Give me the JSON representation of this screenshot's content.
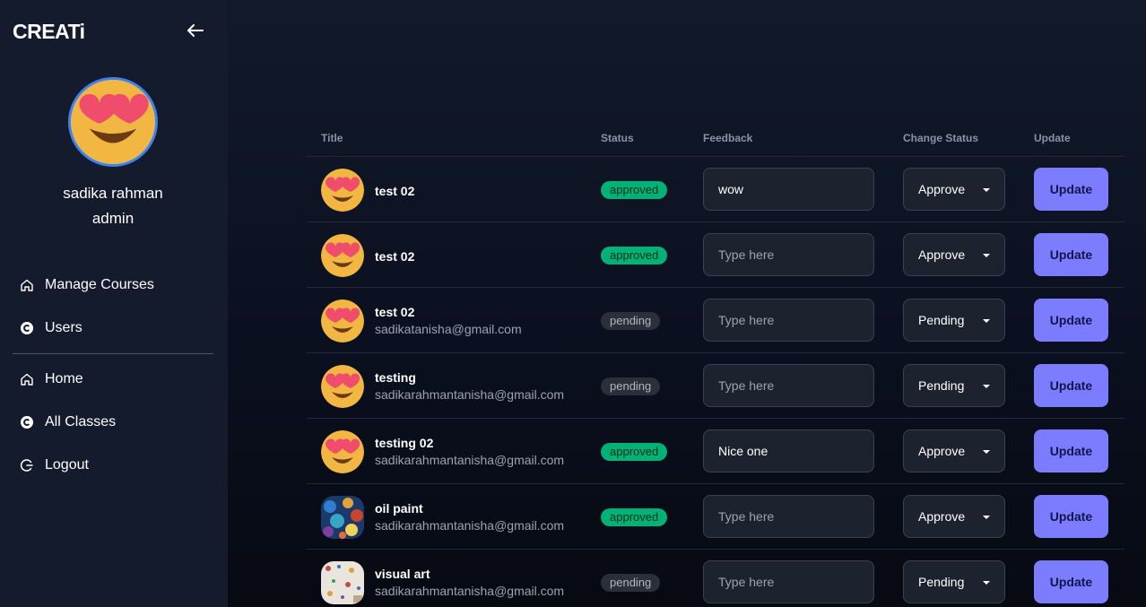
{
  "brand": "CREATi",
  "profile": {
    "name": "sadika rahman",
    "role": "admin"
  },
  "nav": {
    "top": [
      {
        "label": "Manage Courses",
        "icon": "home-icon"
      },
      {
        "label": "Users",
        "icon": "c-circle-icon"
      }
    ],
    "bottom": [
      {
        "label": "Home",
        "icon": "home-icon"
      },
      {
        "label": "All Classes",
        "icon": "c-circle-icon"
      },
      {
        "label": "Logout",
        "icon": "logout-icon"
      }
    ]
  },
  "table": {
    "headers": {
      "title": "Title",
      "status": "Status",
      "feedback": "Feedback",
      "change_status": "Change Status",
      "update": "Update"
    },
    "rows": [
      {
        "title": "test 02",
        "email": "",
        "status": "approved",
        "feedback": "wow",
        "feedback_placeholder": "Type here",
        "change_status": "Approve",
        "update": "Update",
        "thumb": "heart-eyes-emoji"
      },
      {
        "title": "test 02",
        "email": "",
        "status": "approved",
        "feedback": "",
        "feedback_placeholder": "Type here",
        "change_status": "Approve",
        "update": "Update",
        "thumb": "heart-eyes-emoji"
      },
      {
        "title": "test 02",
        "email": "sadikatanisha@gmail.com",
        "status": "pending",
        "feedback": "",
        "feedback_placeholder": "Type here",
        "change_status": "Pending",
        "update": "Update",
        "thumb": "heart-eyes-emoji"
      },
      {
        "title": "testing",
        "email": "sadikarahmantanisha@gmail.com",
        "status": "pending",
        "feedback": "",
        "feedback_placeholder": "Type here",
        "change_status": "Pending",
        "update": "Update",
        "thumb": "heart-eyes-emoji"
      },
      {
        "title": "testing 02",
        "email": "sadikarahmantanisha@gmail.com",
        "status": "approved",
        "feedback": "Nice one",
        "feedback_placeholder": "Type here",
        "change_status": "Approve",
        "update": "Update",
        "thumb": "heart-eyes-emoji"
      },
      {
        "title": "oil paint",
        "email": "sadikarahmantanisha@gmail.com",
        "status": "approved",
        "feedback": "",
        "feedback_placeholder": "Type here",
        "change_status": "Approve",
        "update": "Update",
        "thumb": "oil-paint-image"
      },
      {
        "title": "visual art",
        "email": "sadikarahmantanisha@gmail.com",
        "status": "pending",
        "feedback": "",
        "feedback_placeholder": "Type here",
        "change_status": "Pending",
        "update": "Update",
        "thumb": "visual-art-image"
      }
    ]
  },
  "colors": {
    "sidebar_bg": "#131b2c",
    "accent": "#7b7cff",
    "approved": "#00b276",
    "pending": "#2a2f3a",
    "avatar_ring": "#3b82f6"
  }
}
